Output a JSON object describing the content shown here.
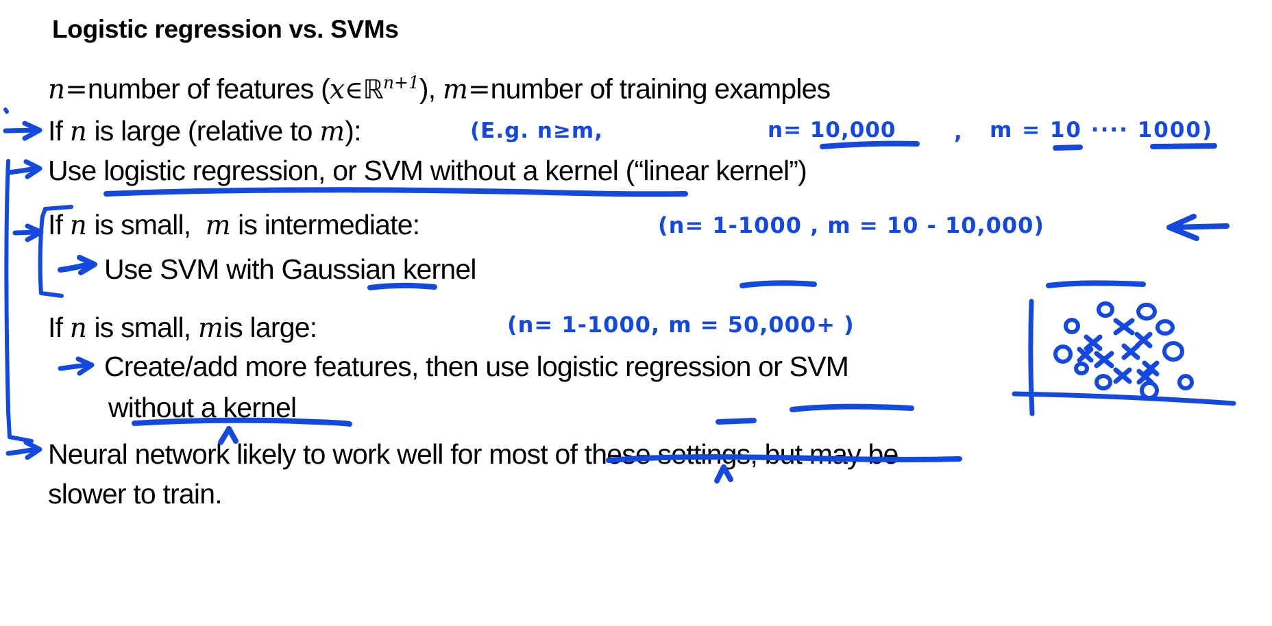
{
  "slide": {
    "title": "Logistic regression vs. SVMs",
    "background_color": "#ffffff",
    "text_color": "#000000",
    "ink_color": "#1449e0"
  },
  "lines": {
    "definition": {
      "n_var": "n",
      "eq1": "=",
      "part1": "number of features (",
      "x_var": "x",
      "in_sym": "∈",
      "reals": "ℝ",
      "exponent": "n+1",
      "part2": "),",
      "m_var": "m",
      "eq2": "=",
      "part3": "number of training examples"
    },
    "case1_condition_pre": "If",
    "case1_condition_n": "n",
    "case1_condition_mid": "is large (relative to",
    "case1_condition_m": "m",
    "case1_condition_post": "):",
    "case1_action": "Use logistic regression, or SVM without a kernel (“linear kernel”)",
    "case2_condition_pre": "If",
    "case2_condition_n": "n",
    "case2_condition_mid": "is small,",
    "case2_condition_m": "m",
    "case2_condition_post": "is intermediate:",
    "case2_action": "Use SVM with Gaussian kernel",
    "case3_condition_pre": "If",
    "case3_condition_n": "n",
    "case3_condition_mid": "is small,",
    "case3_condition_m": "m",
    "case3_condition_post": "is large:",
    "case3_action_line1": "Create/add more features, then use logistic regression or SVM",
    "case3_action_line2": "without a kernel",
    "summary_line1": "Neural network likely to work well for most of these settings, but may be",
    "summary_line2": "slower to train."
  },
  "annotations": {
    "case1_note": "(E.g. n≥m,",
    "case1_note_n": "n= 10,000",
    "case1_note_comma": ",",
    "case1_note_m": "m = 10 ···· 1000)",
    "case2_note": "(n= 1-1000 ,  m = 10 - 10,000)",
    "case3_note": "(n= 1-1000,    m = 50,000+ )",
    "case2_note_arrow": "⟵",
    "underlines": [
      "use-logistic-regression-or-svm-without-a-kernel",
      "gaussian",
      "logistic-regression-or-svm",
      "without-a-kernel",
      "n-10000",
      "m-10-1000",
      "n-1-1000",
      "m-10-10000",
      "m-label",
      "m-50000"
    ],
    "scatter_doodle": {
      "description": "hand-drawn scatter plot with axes, circles and crosses",
      "circles": 12,
      "crosses": 11
    }
  }
}
